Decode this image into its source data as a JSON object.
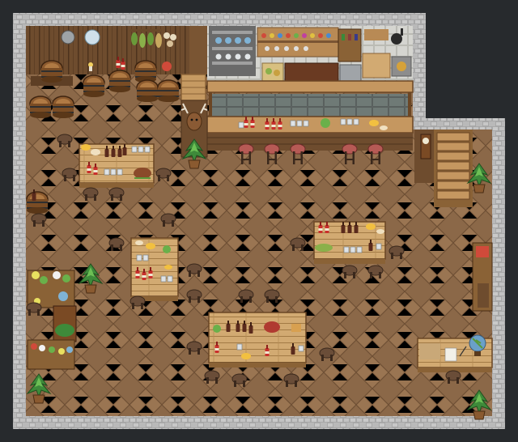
{
  "scene": {
    "kind": "rpg-tavern-interior",
    "palette": {
      "void": "#272a2d",
      "stone_wall": "#b9b9b9",
      "stone_dark": "#8d8d8d",
      "floor_light": "#9a7552",
      "floor_dark": "#7d5b3d",
      "wood_wall": "#6e4c2e",
      "plank": "#d2aa72",
      "plank_dark": "#a27a45",
      "stool": "#5b4433",
      "bar_top": "#c59760",
      "stool_red": "#b65a55"
    },
    "objects": [
      {
        "id": "barrel",
        "name": "barrel"
      },
      {
        "id": "bar-counter",
        "name": "bar-counter"
      },
      {
        "id": "bar-stool",
        "name": "bar-stool"
      },
      {
        "id": "dining-table",
        "name": "dining-table"
      },
      {
        "id": "stool",
        "name": "stool"
      },
      {
        "id": "potted-plant",
        "name": "potted-plant"
      },
      {
        "id": "staircase",
        "name": "staircase"
      },
      {
        "id": "kitchen-shelf",
        "name": "kitchen-shelf"
      },
      {
        "id": "deer-trophy",
        "name": "deer-trophy"
      },
      {
        "id": "wine-bottle",
        "name": "wine-bottle"
      },
      {
        "id": "flower-planter",
        "name": "flower-planter"
      },
      {
        "id": "writing-desk",
        "name": "writing-desk"
      },
      {
        "id": "globe",
        "name": "globe"
      },
      {
        "id": "pendulum-clock",
        "name": "pendulum-clock"
      }
    ]
  }
}
